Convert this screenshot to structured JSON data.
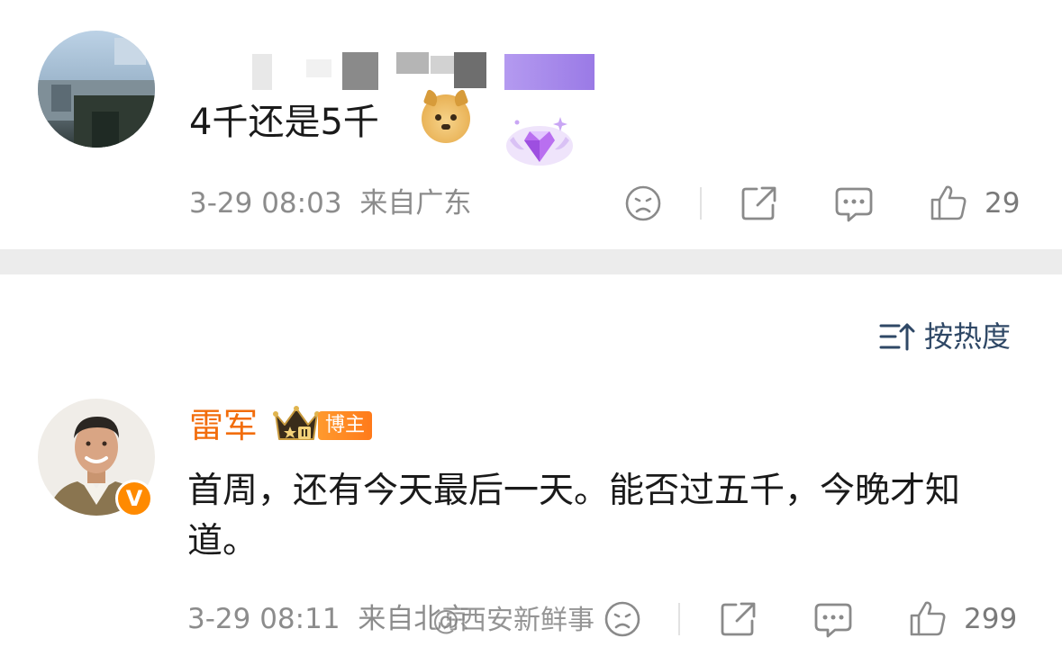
{
  "comment1": {
    "text": "4千还是5千",
    "emoji_icon": "doge-emoji-icon",
    "badge_icon": "purple-diamond-wings-icon",
    "time": "3-29 08:03",
    "location": "来自广东",
    "like_count": "29"
  },
  "sort": {
    "label": "按热度",
    "icon": "sort-icon"
  },
  "comment2": {
    "author": "雷军",
    "author_color": "#f26d0c",
    "role_badge": "博主",
    "level_badge": "II",
    "verified_mark": "V",
    "text": "首周，还有今天最后一天。能否过五千，今晚才知道。",
    "time": "3-29 08:11",
    "location": "来自北京",
    "like_count": "299"
  },
  "watermark": "@西安新鲜事",
  "colors": {
    "meta_gray": "#8c8c8c",
    "sort_blue": "#2f4866",
    "divider_band": "#ececec",
    "orange_badge": "#ff8a00"
  }
}
